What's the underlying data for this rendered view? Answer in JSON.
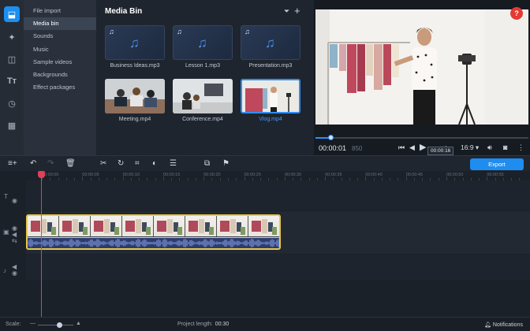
{
  "categories": [
    {
      "label": "File import",
      "selected": false
    },
    {
      "label": "Media bin",
      "selected": true
    },
    {
      "label": "Sounds",
      "selected": false
    },
    {
      "label": "Music",
      "selected": false
    },
    {
      "label": "Sample videos",
      "selected": false
    },
    {
      "label": "Backgrounds",
      "selected": false
    },
    {
      "label": "Effect packages",
      "selected": false
    }
  ],
  "media_bin": {
    "title": "Media Bin",
    "filter_icon": "funnel-icon",
    "add_icon": "plus-icon",
    "items": [
      {
        "name": "Business Ideas.mp3",
        "kind": "audio",
        "selected": false
      },
      {
        "name": "Lesson 1.mp3",
        "kind": "audio",
        "selected": false
      },
      {
        "name": "Presentation.mp3",
        "kind": "audio",
        "selected": false
      },
      {
        "name": "Meeting.mp4",
        "kind": "video",
        "selected": false
      },
      {
        "name": "Conference.mp4",
        "kind": "video",
        "selected": false
      },
      {
        "name": "Vlog.mp4",
        "kind": "video",
        "selected": true
      }
    ]
  },
  "preview": {
    "help": "?",
    "timecode": "00:00:01",
    "timecode_ms": "850",
    "tooltip": "00:00:16",
    "aspect": "16:9 ▾",
    "progress_fraction": 0.07
  },
  "toolbar": {
    "export_label": "Export"
  },
  "ruler": {
    "labels": [
      "00:00:00",
      "00:00:05",
      "00:00:10",
      "00:00:15",
      "00:00:20",
      "00:00:25",
      "00:00:30",
      "00:00:35",
      "00:00:40",
      "00:00:45",
      "00:00:50",
      "00:00:55"
    ]
  },
  "statusbar": {
    "scale_label": "Scale:",
    "project_length_label": "Project length:",
    "project_length_value": "00:30",
    "notifications_label": "Notifications",
    "scale_fraction": 0.6
  },
  "colors": {
    "accent": "#1f8cf0",
    "clip_border": "#e6c84a",
    "playhead": "#e0405a",
    "help_button": "#e53935"
  }
}
